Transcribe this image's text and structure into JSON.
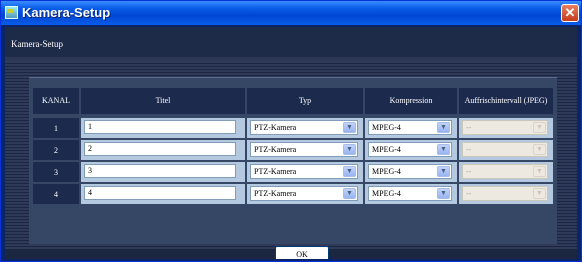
{
  "window": {
    "title": "Kamera-Setup",
    "close_glyph": "✕"
  },
  "page": {
    "title": "Kamera-Setup"
  },
  "table": {
    "headers": {
      "kanal": "KANAL",
      "titel": "Titel",
      "typ": "Typ",
      "kompression": "Kompression",
      "intervall": "Auffrischintervall (JPEG)"
    },
    "rows": [
      {
        "kanal": "1",
        "titel": "1",
        "typ": "PTZ-Kamera",
        "kompression": "MPEG-4",
        "intervall": "--"
      },
      {
        "kanal": "2",
        "titel": "2",
        "typ": "PTZ-Kamera",
        "kompression": "MPEG-4",
        "intervall": "--"
      },
      {
        "kanal": "3",
        "titel": "3",
        "typ": "PTZ-Kamera",
        "kompression": "MPEG-4",
        "intervall": "--"
      },
      {
        "kanal": "4",
        "titel": "4",
        "typ": "PTZ-Kamera",
        "kompression": "MPEG-4",
        "intervall": "--"
      }
    ]
  },
  "buttons": {
    "ok": "OK"
  },
  "icons": {
    "dropdown": "chevron-down-icon",
    "window": "camera-setup-app-icon",
    "close": "close-icon"
  },
  "colors": {
    "titlebar": "#0a5de8",
    "panel": "#364766",
    "header_cell": "#1c2a4e",
    "cell_bg": "#b4c8e0"
  }
}
